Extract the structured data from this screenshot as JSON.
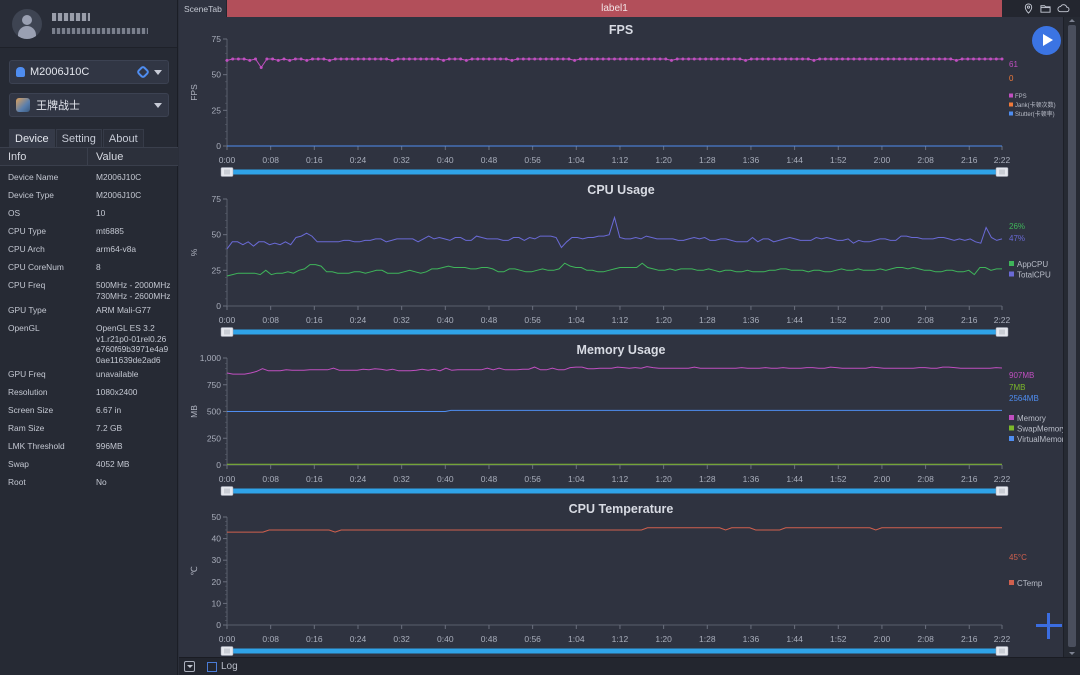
{
  "profile": {
    "name_masked": "██ █▌",
    "email_masked": "███.██ ▪ ▪ ███"
  },
  "device_select": {
    "value": "M2006J10C",
    "icon": "android-icon",
    "link_icon": "link-icon"
  },
  "app_select": {
    "value": "王牌战士",
    "icon": "game-icon"
  },
  "sidebar_tabs": [
    {
      "label": "Device",
      "active": true
    },
    {
      "label": "Setting",
      "active": false
    },
    {
      "label": "About",
      "active": false
    }
  ],
  "info_table": {
    "headers": [
      "Info",
      "Value"
    ],
    "rows": [
      {
        "key": "Device Name",
        "value": "M2006J10C"
      },
      {
        "key": "Device Type",
        "value": "M2006J10C"
      },
      {
        "key": "OS",
        "value": "10"
      },
      {
        "key": "CPU Type",
        "value": "mt6885"
      },
      {
        "key": "CPU Arch",
        "value": "arm64-v8a"
      },
      {
        "key": "CPU CoreNum",
        "value": "8"
      },
      {
        "key": "CPU Freq",
        "value": "500MHz - 2000MHz\n730MHz - 2600MHz"
      },
      {
        "key": "GPU Type",
        "value": "ARM Mali-G77"
      },
      {
        "key": "OpenGL",
        "value": "OpenGL ES 3.2\nv1.r21p0-01rel0.26\ne760f69b3971e4a9\n0ae11639de2ad6"
      },
      {
        "key": "GPU Freq",
        "value": "unavailable"
      },
      {
        "key": "Resolution",
        "value": "1080x2400"
      },
      {
        "key": "Screen Size",
        "value": "6.67 in"
      },
      {
        "key": "Ram Size",
        "value": "7.2 GB"
      },
      {
        "key": "LMK Threshold",
        "value": "996MB"
      },
      {
        "key": "Swap",
        "value": "4052 MB"
      },
      {
        "key": "Root",
        "value": "No"
      }
    ]
  },
  "topbar": {
    "scene_tab": "SceneTab",
    "label": "label1",
    "accent_color": "#b24f5a",
    "icons": [
      "location-pin-icon",
      "folder-icon",
      "cloud-icon"
    ]
  },
  "bottombar": {
    "log_label": "Log",
    "log_checked": false
  },
  "chart_data": [
    {
      "type": "line",
      "title": "FPS",
      "ylabel": "FPS",
      "xlabel": "",
      "ylim": [
        0,
        75
      ],
      "yticks": [
        0,
        25,
        50,
        75
      ],
      "xticks": [
        "0:00",
        "0:08",
        "0:16",
        "0:24",
        "0:32",
        "0:40",
        "0:48",
        "0:56",
        "1:04",
        "1:12",
        "1:20",
        "1:28",
        "1:36",
        "1:44",
        "1:52",
        "2:00",
        "2:08",
        "2:16",
        "2:22"
      ],
      "duration_s": 142,
      "series": [
        {
          "name": "FPS",
          "color": "#c04fc0",
          "current": "61",
          "markers": true,
          "values": [
            60,
            61,
            61,
            61,
            60,
            61,
            55,
            61,
            61,
            60,
            61,
            60,
            61,
            61,
            60,
            61,
            61,
            61,
            60,
            61,
            61,
            61,
            61,
            61,
            61,
            61,
            61,
            61,
            61,
            60,
            61,
            61,
            61,
            61,
            61,
            61,
            61,
            61,
            60,
            61,
            61,
            61,
            60,
            61,
            61,
            61,
            61,
            61,
            61,
            61,
            60,
            61,
            61,
            61,
            61,
            61,
            61,
            61,
            61,
            61,
            61,
            60,
            61,
            61,
            61,
            61,
            61,
            61,
            61,
            61,
            61,
            61,
            61,
            61,
            61,
            61,
            61,
            61,
            60,
            61,
            61,
            61,
            61,
            61,
            61,
            61,
            61,
            61,
            61,
            61,
            61,
            60,
            61,
            61,
            61,
            61,
            61,
            61,
            61,
            61,
            61,
            61,
            61,
            60,
            61,
            61,
            61,
            61,
            61,
            61,
            61,
            61,
            61,
            61,
            61,
            61,
            61,
            61,
            61,
            61,
            61,
            61,
            61,
            61,
            61,
            61,
            61,
            61,
            60,
            61,
            61,
            61,
            61,
            61,
            61,
            61,
            61
          ]
        },
        {
          "name": "Jank(卡顿次数)",
          "color": "#f07a3a",
          "current": "0",
          "markers": false,
          "values": "all 0"
        },
        {
          "name": "Stutter(卡顿率)",
          "color": "#4f8df0",
          "current": "",
          "markers": false,
          "values": "all 0"
        }
      ],
      "legend": "right"
    },
    {
      "type": "line",
      "title": "CPU Usage",
      "ylabel": "%",
      "ylim": [
        0,
        75
      ],
      "yticks": [
        0,
        25,
        50,
        75
      ],
      "xticks": [
        "0:00",
        "0:08",
        "0:16",
        "0:24",
        "0:32",
        "0:40",
        "0:48",
        "0:56",
        "1:04",
        "1:12",
        "1:20",
        "1:28",
        "1:36",
        "1:44",
        "1:52",
        "2:00",
        "2:08",
        "2:16",
        "2:22"
      ],
      "duration_s": 142,
      "series": [
        {
          "name": "AppCPU",
          "color": "#3fb55a",
          "current": "26%",
          "values": [
            21,
            22,
            23,
            23,
            23,
            23,
            22,
            25,
            22,
            23,
            23,
            24,
            23,
            25,
            26,
            29,
            29,
            28,
            24,
            24,
            23,
            23,
            23,
            24,
            24,
            23,
            24,
            25,
            25,
            23,
            23,
            23,
            24,
            25,
            24,
            23,
            24,
            26,
            26,
            27,
            28,
            27,
            27,
            27,
            26,
            26,
            27,
            27,
            26,
            24,
            24,
            26,
            26,
            25,
            24,
            24,
            25,
            26,
            25,
            25,
            26,
            30,
            28,
            27,
            27,
            25,
            25,
            24,
            24,
            25,
            26,
            27,
            27,
            27,
            27,
            30,
            27,
            26,
            25,
            25,
            26,
            25,
            26,
            26,
            26,
            25,
            25,
            26,
            25,
            24,
            25,
            25,
            24,
            24,
            25,
            24,
            24,
            24,
            25,
            25,
            26,
            26,
            25,
            25,
            25,
            24,
            25,
            25,
            24,
            24,
            25,
            26,
            25,
            25,
            26,
            25,
            25,
            25,
            26,
            25,
            26,
            27,
            27,
            26,
            27,
            26,
            25,
            25,
            24,
            24,
            25,
            25,
            24,
            24,
            25,
            22,
            27,
            27,
            25,
            26,
            26
          ]
        },
        {
          "name": "TotalCPU",
          "color": "#6a6ad6",
          "current": "47%",
          "values": [
            40,
            45,
            45,
            43,
            45,
            42,
            45,
            45,
            43,
            44,
            43,
            45,
            43,
            48,
            49,
            51,
            49,
            45,
            45,
            45,
            45,
            45,
            46,
            46,
            45,
            45,
            46,
            46,
            47,
            47,
            45,
            46,
            47,
            47,
            47,
            47,
            45,
            47,
            49,
            47,
            48,
            47,
            46,
            48,
            48,
            46,
            46,
            49,
            48,
            47,
            47,
            47,
            46,
            46,
            48,
            48,
            46,
            48,
            47,
            49,
            49,
            49,
            48,
            41,
            45,
            48,
            48,
            47,
            48,
            48,
            49,
            49,
            50,
            62,
            48,
            47,
            47,
            48,
            47,
            49,
            48,
            47,
            47,
            47,
            47,
            46,
            46,
            47,
            48,
            47,
            48,
            46,
            46,
            47,
            47,
            46,
            45,
            45,
            45,
            48,
            45,
            47,
            47,
            45,
            46,
            47,
            48,
            47,
            46,
            46,
            46,
            48,
            47,
            48,
            47,
            46,
            46,
            47,
            44,
            46,
            45,
            45,
            46,
            47,
            47,
            46,
            46,
            49,
            49,
            48,
            48,
            47,
            47,
            47,
            48,
            48,
            47,
            46,
            47,
            46,
            47,
            45,
            44,
            55,
            48,
            46,
            47
          ]
        }
      ],
      "legend": "right"
    },
    {
      "type": "line",
      "title": "Memory Usage",
      "ylabel": "MB",
      "ylim": [
        0,
        1000
      ],
      "yticks": [
        0,
        250,
        500,
        750,
        "1,000"
      ],
      "xticks": [
        "0:00",
        "0:08",
        "0:16",
        "0:24",
        "0:32",
        "0:40",
        "0:48",
        "0:56",
        "1:04",
        "1:12",
        "1:20",
        "1:28",
        "1:36",
        "1:44",
        "1:52",
        "2:00",
        "2:08",
        "2:16",
        "2:22"
      ],
      "duration_s": 142,
      "series": [
        {
          "name": "Memory",
          "color": "#c04fc0",
          "current": "907MB",
          "values": [
            860,
            850,
            850,
            850,
            860,
            875,
            900,
            880,
            880,
            880,
            890,
            885,
            885,
            885,
            890,
            890,
            890,
            890,
            905,
            885,
            885,
            885,
            885,
            895,
            890,
            900,
            895,
            885,
            895,
            880,
            880,
            880,
            885,
            895,
            885,
            895,
            880,
            905,
            885,
            890,
            890,
            890,
            890,
            890,
            905,
            890,
            905,
            890,
            890,
            890,
            895,
            895,
            915,
            890,
            890,
            905,
            890,
            890,
            910,
            915,
            915,
            900,
            900,
            905,
            905,
            905,
            915,
            910,
            905,
            910,
            905,
            920,
            910,
            905,
            905,
            905,
            905,
            905,
            905,
            915,
            905,
            905,
            905,
            905,
            905,
            905,
            905,
            910,
            905,
            905,
            905,
            910,
            905,
            905,
            910,
            905,
            905,
            905,
            910,
            910,
            905,
            905,
            915,
            910,
            905,
            905,
            905,
            905,
            905,
            915,
            910,
            905,
            905,
            905,
            905,
            905,
            905,
            910,
            910,
            905,
            905,
            915,
            915,
            910,
            905,
            905,
            905,
            905,
            905,
            905,
            910,
            907
          ]
        },
        {
          "name": "SwapMemory",
          "color": "#7cb82a",
          "current": "7MB",
          "values": "approximately constant 7"
        },
        {
          "name": "VirtualMemory",
          "color": "#4f8df0",
          "current": "2564MB",
          "values": "plotted ~500 from 0:00-0:40, ~510 from 0:40-2:22 (scaled)"
        }
      ],
      "legend": "right"
    },
    {
      "type": "line",
      "title": "CPU Temperature",
      "ylabel": "℃",
      "ylim": [
        0,
        50
      ],
      "yticks": [
        0,
        10,
        20,
        30,
        40,
        50
      ],
      "xticks": [
        "0:00",
        "0:08",
        "0:16",
        "0:24",
        "0:32",
        "0:40",
        "0:48",
        "0:56",
        "1:04",
        "1:12",
        "1:20",
        "1:28",
        "1:36",
        "1:44",
        "1:52",
        "2:00",
        "2:08",
        "2:16",
        "2:22"
      ],
      "duration_s": 142,
      "series": [
        {
          "name": "CTemp",
          "color": "#d0604e",
          "current": "45°C",
          "values": [
            43,
            43,
            43,
            43,
            43,
            43,
            43,
            44,
            44,
            44,
            44,
            44,
            44,
            44,
            44,
            44,
            44,
            44,
            43,
            44,
            44,
            44,
            44,
            44,
            44,
            44,
            44,
            44,
            44,
            44,
            44,
            44,
            44,
            44,
            44,
            44,
            44,
            44,
            44,
            44,
            44,
            44,
            44,
            44,
            44,
            44,
            44,
            44,
            44,
            44,
            44,
            44,
            44,
            44,
            44,
            44,
            44,
            44,
            44,
            44,
            44,
            44,
            44,
            44,
            44,
            44,
            44,
            44,
            44,
            44,
            45,
            45,
            45,
            45,
            45,
            45,
            45,
            45,
            45,
            45,
            45,
            45,
            45,
            44,
            45,
            45,
            45,
            45,
            44,
            44,
            44,
            44,
            44,
            45,
            45,
            45,
            45,
            45,
            45,
            45,
            45,
            45,
            45,
            45,
            45,
            45,
            45,
            45,
            44,
            45,
            45,
            45,
            45,
            45,
            45,
            45,
            45,
            45,
            45,
            45,
            45,
            45,
            45,
            45,
            45,
            45,
            45,
            45,
            45,
            45
          ]
        }
      ],
      "legend": "right"
    }
  ],
  "buttons": {
    "play": "play-icon",
    "add": "plus-icon"
  }
}
